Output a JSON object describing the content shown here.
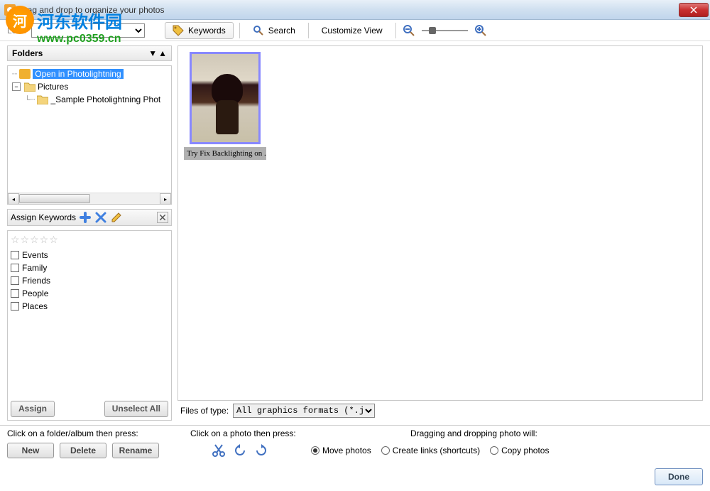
{
  "window": {
    "title": "Drag and drop to organize your photos"
  },
  "watermark": {
    "title": "河东软件园",
    "url": "www.pc0359.cn"
  },
  "toolbar": {
    "look_label": "Look",
    "keywords_btn": "Keywords",
    "search_btn": "Search",
    "customize_btn": "Customize View"
  },
  "folders": {
    "header": "Folders",
    "items": [
      {
        "label": "Open in Photolightning",
        "selected": true,
        "indent": 0,
        "expander": null,
        "icon": "app"
      },
      {
        "label": "Pictures",
        "selected": false,
        "indent": 0,
        "expander": "-",
        "icon": "folder"
      },
      {
        "label": "_Sample Photolightning Phot",
        "selected": false,
        "indent": 1,
        "expander": null,
        "icon": "folder"
      }
    ]
  },
  "keywords": {
    "header": "Assign Keywords",
    "items": [
      "Events",
      "Family",
      "Friends",
      "People",
      "Places"
    ],
    "assign_btn": "Assign",
    "unselect_btn": "Unselect All"
  },
  "thumbnails": [
    {
      "caption": "Try Fix Backlighting on ..."
    }
  ],
  "filetype": {
    "label": "Files of type:",
    "selected": "All graphics formats (*.jpg,*."
  },
  "bottom": {
    "folder_hint": "Click on a folder/album then press:",
    "photo_hint": "Click on a photo then press:",
    "drop_hint": "Dragging and dropping photo will:",
    "new_btn": "New",
    "delete_btn": "Delete",
    "rename_btn": "Rename",
    "radios": {
      "move": "Move photos",
      "links": "Create links (shortcuts)",
      "copy": "Copy photos"
    },
    "done_btn": "Done"
  }
}
